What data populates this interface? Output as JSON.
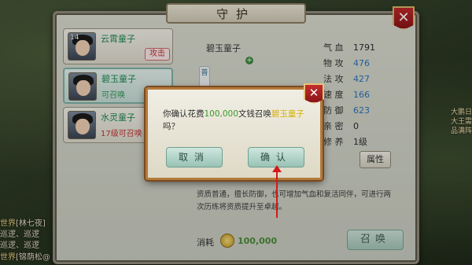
{
  "panel": {
    "title": "守护"
  },
  "chat": [
    {
      "tag": "世界",
      "text": "[林七夜]"
    },
    {
      "tag": "",
      "text": "巡逻、巡逻"
    },
    {
      "tag": "",
      "text": "巡逻、巡逻"
    },
    {
      "tag": "世界",
      "text": "[锦荫松@"
    }
  ],
  "guardians": [
    {
      "level": "14",
      "name": "云霄童子",
      "tag": "攻击",
      "status": ""
    },
    {
      "level": "",
      "name": "碧玉童子",
      "tag": "",
      "status": "可召唤"
    },
    {
      "level": "",
      "name": "水灵童子",
      "tag": "",
      "status": "17级可召唤"
    }
  ],
  "selected": {
    "name": "碧玉童子",
    "side_tab": "普"
  },
  "stats": [
    {
      "label": "气 血",
      "value": "1791"
    },
    {
      "label": "物 攻",
      "value": "476"
    },
    {
      "label": "法 攻",
      "value": "427"
    },
    {
      "label": "速 度",
      "value": "166"
    },
    {
      "label": "防 御",
      "value": "623"
    },
    {
      "label": "亲 密",
      "value": "0"
    },
    {
      "label": "修 养",
      "value": "1级"
    }
  ],
  "attr_button": "属性",
  "description": "资质普通，擅长防御，也可增加气血和复活同伴，可进行两次历练将资质提升至卓越。",
  "cost": {
    "label": "消耗",
    "value": "100,000"
  },
  "summon_button": "召唤",
  "dialog": {
    "msg_prefix": "你确认花费",
    "msg_amount": "100,000",
    "msg_mid": "文钱召唤",
    "msg_name": "碧玉童子",
    "msg_suffix": "吗？",
    "cancel_label": "取消",
    "confirm_label": "确认",
    "close_symbol": "✕"
  },
  "right_hints": [
    "大鹏日",
    "大王需",
    "品满阵"
  ],
  "colors": {
    "accent_green": "#3a9a2a",
    "accent_yellow": "#d8b000",
    "red_close": "#c1282b",
    "button_teal": "#9ec5b8"
  }
}
